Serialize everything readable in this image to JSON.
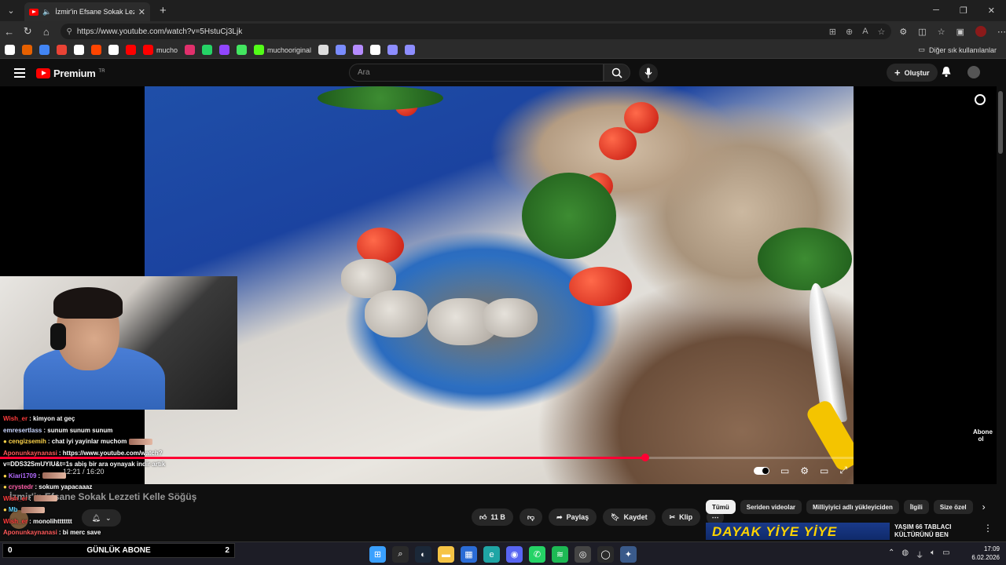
{
  "browser": {
    "tab_title": "İzmir'in Efsane Sokak Lezzeti K",
    "url": "https://www.youtube.com/watch?v=5HstuCj3Ljk",
    "bookmarks": [
      {
        "label": "",
        "icon": "folder-icon",
        "color": "#ffffff"
      },
      {
        "label": "",
        "icon": "firefox-icon",
        "color": "#e66000"
      },
      {
        "label": "",
        "icon": "docs-icon",
        "color": "#4285f4"
      },
      {
        "label": "",
        "icon": "gmail-icon",
        "color": "#ea4335"
      },
      {
        "label": "",
        "icon": "google-icon",
        "color": "#ffffff"
      },
      {
        "label": "",
        "icon": "reddit-icon",
        "color": "#ff4500"
      },
      {
        "label": "",
        "icon": "x-icon",
        "color": "#ffffff"
      },
      {
        "label": "",
        "icon": "youtube-icon",
        "color": "#ff0000"
      },
      {
        "label": "mucho",
        "icon": "youtube-icon",
        "color": "#ff0000"
      },
      {
        "label": "",
        "icon": "instagram-icon",
        "color": "#e1306c"
      },
      {
        "label": "",
        "icon": "whatsapp-icon",
        "color": "#25d366"
      },
      {
        "label": "",
        "icon": "twitch-icon",
        "color": "#9146ff"
      },
      {
        "label": "",
        "icon": "linktree-icon",
        "color": "#43e660"
      },
      {
        "label": "muchooriginal",
        "icon": "kick-icon",
        "color": "#53fc18"
      },
      {
        "label": "",
        "icon": "app-icon",
        "color": "#dddddd"
      },
      {
        "label": "",
        "icon": "app-icon",
        "color": "#7a8cff"
      },
      {
        "label": "",
        "icon": "pen-icon",
        "color": "#b58cff"
      },
      {
        "label": "",
        "icon": "tm-icon",
        "color": "#ffffff"
      },
      {
        "label": "",
        "icon": "shield-icon",
        "color": "#8d8dff"
      },
      {
        "label": "",
        "icon": "shield-icon",
        "color": "#8d8dff"
      }
    ],
    "bookmarks_other": "Diğer sık kullanılanlar"
  },
  "youtube": {
    "logo_text": "Premium",
    "logo_region": "TR",
    "search_placeholder": "Ara",
    "create_label": "Oluştur",
    "video_title": "İzmir'in Efsane Sokak Lezzeti Kelle Söğüş",
    "time": "12:21 / 16:20",
    "progress": 0.756,
    "watermark": "Abone ol",
    "like_count": "11 B",
    "share_label": "Paylaş",
    "save_label": "Kaydet",
    "clip_label": "Klip",
    "chips": [
      "Tümü",
      "Seriden videolar",
      "Milliyiyici adlı yükleyiciden",
      "İlgili",
      "Size özel"
    ],
    "rec_thumb_text": "DAYAK YİYE YİYE",
    "rec_title": "YAŞIM 66 TABLACI KÜLTÜRÜNÜ BEN"
  },
  "chat": [
    {
      "user": "Wish_er",
      "user_color": "#ff3b3b",
      "text": ": kimyon at geç",
      "badge": false,
      "image": false
    },
    {
      "user": "emresertlass",
      "user_color": "#c9d6ff",
      "text": ": sunum sunum sunum",
      "badge": false,
      "image": false
    },
    {
      "user": "cengizsemih",
      "user_color": "#ffd54a",
      "text": ": chat iyi yayinlar muchom",
      "badge": true,
      "image": true
    },
    {
      "user": "Aponunkaynanasi",
      "user_color": "#ff5a5a",
      "text": ": https://www.youtube.com/watch?",
      "badge": false,
      "image": false
    },
    {
      "user": "",
      "user_color": "#ffffff",
      "text": "v=DDS32SmUYIU&t=1s abiş bir ara oynayak indir artık",
      "badge": false,
      "image": false
    },
    {
      "user": "Kiari1709",
      "user_color": "#b46bff",
      "text": ":",
      "badge": true,
      "image": true
    },
    {
      "user": "crystedr",
      "user_color": "#ff5ea8",
      "text": ": sokum yapacaaaz",
      "badge": true,
      "image": false
    },
    {
      "user": "Wish_er",
      "user_color": "#ff3b3b",
      "text": ":",
      "badge": false,
      "image": true
    },
    {
      "user": "Mb",
      "user_color": "#5fd3ff",
      "text": "",
      "badge": true,
      "image": true
    },
    {
      "user": "Wish_er",
      "user_color": "#ff3b3b",
      "text": ": monolihttttttt",
      "badge": false,
      "image": false
    },
    {
      "user": "Aponunkaynanasi",
      "user_color": "#ff5a5a",
      "text": ": bi merc save",
      "badge": false,
      "image": false
    }
  ],
  "counter": {
    "left": "0",
    "label": "GÜNLÜK ABONE",
    "right": "2"
  },
  "taskbar": {
    "apps": [
      {
        "icon": "windows-icon",
        "color": "#3aa0ff",
        "glyph": "⊞"
      },
      {
        "icon": "search-icon",
        "color": "#2a2a2a",
        "glyph": "⌕"
      },
      {
        "icon": "steam-icon",
        "color": "#1b2838",
        "glyph": "◐"
      },
      {
        "icon": "folder-icon",
        "color": "#f6c445",
        "glyph": "▬"
      },
      {
        "icon": "store-icon",
        "color": "#2b6cd6",
        "glyph": "▦"
      },
      {
        "icon": "edge-icon",
        "color": "#1fa5a5",
        "glyph": "e"
      },
      {
        "icon": "discord-icon",
        "color": "#5865f2",
        "glyph": "◉"
      },
      {
        "icon": "whatsapp-icon",
        "color": "#25d366",
        "glyph": "✆"
      },
      {
        "icon": "spotify-icon",
        "color": "#1db954",
        "glyph": "≋"
      },
      {
        "icon": "app-icon",
        "color": "#444444",
        "glyph": "◎"
      },
      {
        "icon": "app-icon",
        "color": "#2a2a2a",
        "glyph": "◯"
      },
      {
        "icon": "app-icon",
        "color": "#3a5a8a",
        "glyph": "✦"
      }
    ],
    "time": "17:09",
    "date": "6.02.2026"
  }
}
